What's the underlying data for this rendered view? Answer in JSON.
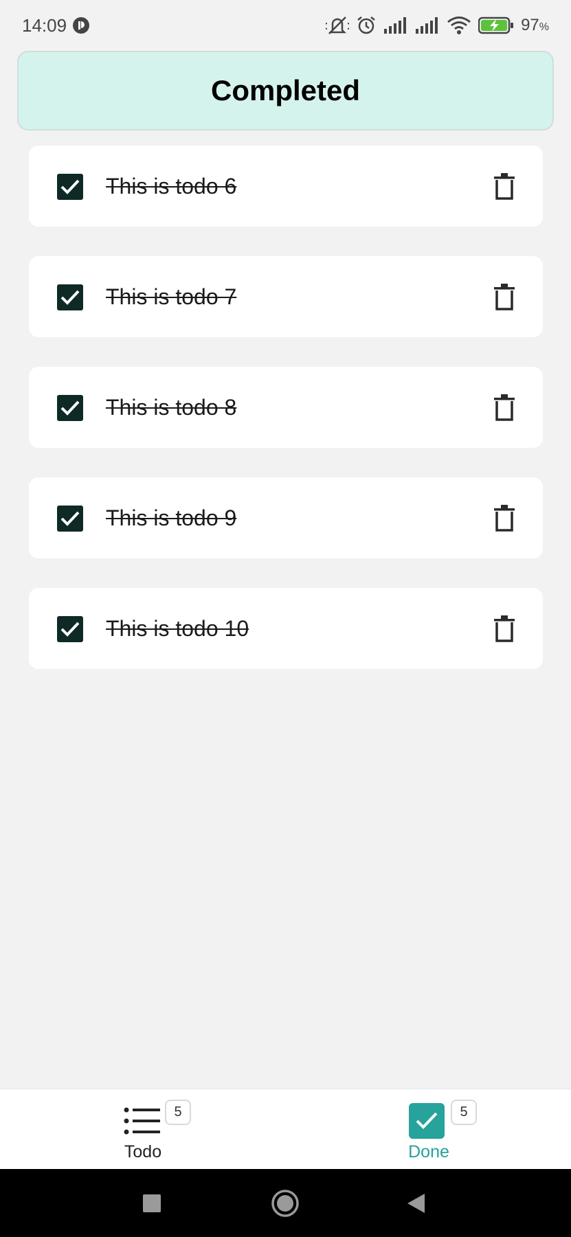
{
  "status_bar": {
    "time": "14:09",
    "battery_pct": "97",
    "battery_unit": "%"
  },
  "header": {
    "title": "Completed"
  },
  "todos": [
    {
      "label": "This is todo 6",
      "checked": true
    },
    {
      "label": "This is todo 7",
      "checked": true
    },
    {
      "label": "This is todo 8",
      "checked": true
    },
    {
      "label": "This is todo 9",
      "checked": true
    },
    {
      "label": "This is todo 10",
      "checked": true
    }
  ],
  "bottom_nav": {
    "todo": {
      "label": "Todo",
      "badge": "5"
    },
    "done": {
      "label": "Done",
      "badge": "5",
      "active": true
    }
  },
  "colors": {
    "accent": "#26a39a",
    "header_bg": "#d5f3ed",
    "checkbox": "#0f2a26"
  },
  "icons": {
    "status": [
      "app-notification-icon",
      "mute-icon",
      "alarm-icon",
      "signal-icon",
      "signal-icon",
      "wifi-icon",
      "battery-charging-icon"
    ],
    "todo_item": [
      "checkbox-checked-icon",
      "trash-icon"
    ],
    "nav": [
      "list-icon",
      "checkmark-icon"
    ],
    "system": [
      "recents-icon",
      "home-icon",
      "back-icon"
    ]
  }
}
